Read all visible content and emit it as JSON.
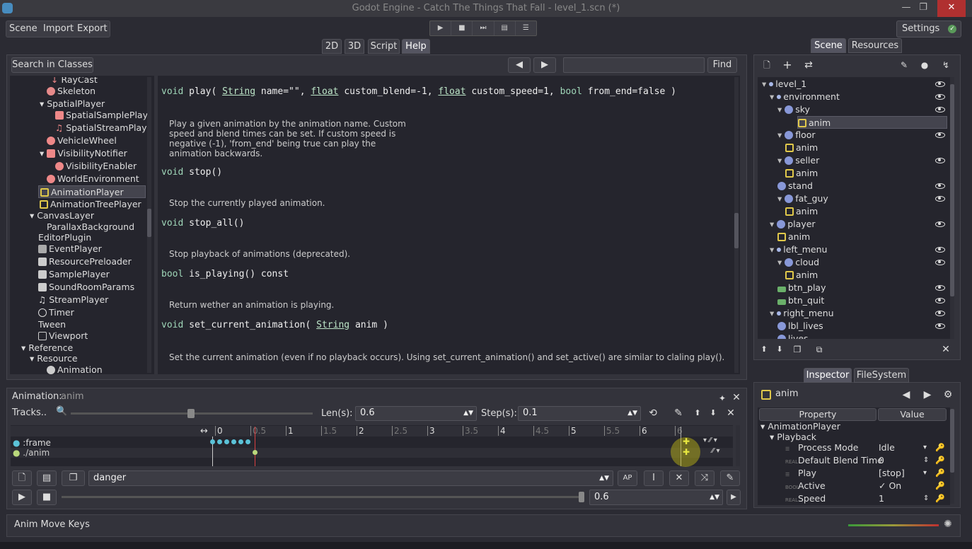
{
  "window": {
    "title": "Godot Engine - Catch The Things That Fall - level_1.scn (*)",
    "min": "—",
    "max": "❐",
    "close": "✕"
  },
  "menu": {
    "scene": "Scene",
    "import": "Import",
    "export": "Export",
    "settings": "Settings"
  },
  "main_tabs": [
    "2D",
    "3D",
    "Script",
    "Help"
  ],
  "help": {
    "search_classes": "Search in Classes",
    "find": "Find",
    "search_value": "",
    "class_tree": [
      "RayCast",
      "Skeleton",
      "SpatialPlayer",
      "SpatialSamplePlay",
      "SpatialStreamPlay",
      "VehicleWheel",
      "VisibilityNotifier",
      "VisibilityEnabler",
      "WorldEnvironment",
      "AnimationPlayer",
      "AnimationTreePlayer",
      "CanvasLayer",
      "ParallaxBackground",
      "EditorPlugin",
      "EventPlayer",
      "ResourcePreloader",
      "SamplePlayer",
      "SoundRoomParams",
      "StreamPlayer",
      "Timer",
      "Tween",
      "Viewport",
      "Reference",
      "Resource",
      "Animation"
    ],
    "methods": [
      {
        "ret": "void",
        "name": "play(",
        "args_html": " <span class=\"ty\">String</span> name=\"\", <span class=\"ty\">float</span> custom_blend=-1, <span class=\"ty\">float</span> custom_speed=1, <span class=\"kw\">bool</span> from_end=false )",
        "desc": "Play a given animation by the animation name. Custom\nspeed and blend times can be set. If custom speed is\nnegative (-1), 'from_end' being true can play the\nanimation backwards."
      },
      {
        "ret": "void",
        "name": "stop()",
        "args_html": "",
        "desc": "Stop the currently played animation."
      },
      {
        "ret": "void",
        "name": "stop_all()",
        "args_html": "",
        "desc": "Stop playback of animations (deprecated)."
      },
      {
        "ret": "bool",
        "name": "is_playing() const",
        "args_html": "",
        "desc": "Return wether an animation is playing."
      },
      {
        "ret": "void",
        "name": "set_current_animation(",
        "args_html": " <span class=\"ty\">String</span> anim )",
        "desc": "Set the current animation (even if no playback occurs). Using set_current_animation() and set_active() are similar to claling play()."
      }
    ]
  },
  "scene_tabs": [
    "Scene",
    "Resources"
  ],
  "scene_tree": [
    {
      "label": "level_1",
      "indent": 0
    },
    {
      "label": "environment",
      "indent": 1
    },
    {
      "label": "sky",
      "indent": 2
    },
    {
      "label": "anim",
      "indent": 3
    },
    {
      "label": "floor",
      "indent": 2
    },
    {
      "label": "anim",
      "indent": 3
    },
    {
      "label": "seller",
      "indent": 2
    },
    {
      "label": "anim",
      "indent": 3
    },
    {
      "label": "stand",
      "indent": 2
    },
    {
      "label": "fat_guy",
      "indent": 2
    },
    {
      "label": "anim",
      "indent": 3
    },
    {
      "label": "player",
      "indent": 1
    },
    {
      "label": "anim",
      "indent": 2
    },
    {
      "label": "left_menu",
      "indent": 1
    },
    {
      "label": "cloud",
      "indent": 2
    },
    {
      "label": "anim",
      "indent": 3
    },
    {
      "label": "btn_play",
      "indent": 2
    },
    {
      "label": "btn_quit",
      "indent": 2
    },
    {
      "label": "right_menu",
      "indent": 1
    },
    {
      "label": "lbl_lives",
      "indent": 2
    },
    {
      "label": "lives",
      "indent": 2
    }
  ],
  "inspector": {
    "tabs": [
      "Inspector",
      "FileSystem"
    ],
    "object": "anim",
    "col_property": "Property",
    "col_value": "Value",
    "section": "AnimationPlayer",
    "subsection": "Playback",
    "props": [
      {
        "name": "Process Mode",
        "value": "Idle"
      },
      {
        "name": "Default Blend Time",
        "value": "0"
      },
      {
        "name": "Play",
        "value": "[stop]"
      },
      {
        "name": "Active",
        "value": "✓ On"
      },
      {
        "name": "Speed",
        "value": "1"
      }
    ]
  },
  "animation": {
    "title": "Animation:",
    "name": "anim",
    "tracks_btn": "Tracks..",
    "len_label": "Len(s):",
    "len_value": "0.6",
    "step_label": "Step(s):",
    "step_value": "0.1",
    "ruler": [
      "0",
      "0.5",
      "1",
      "1.5",
      "2",
      "2.5",
      "3",
      "3.5",
      "4",
      "4.5",
      "5",
      "5.5",
      "6",
      "6"
    ],
    "tracks": [
      ":frame",
      "./anim"
    ],
    "anim_select": "danger",
    "position": "0.6"
  },
  "status": {
    "text": "Anim Move Keys"
  }
}
